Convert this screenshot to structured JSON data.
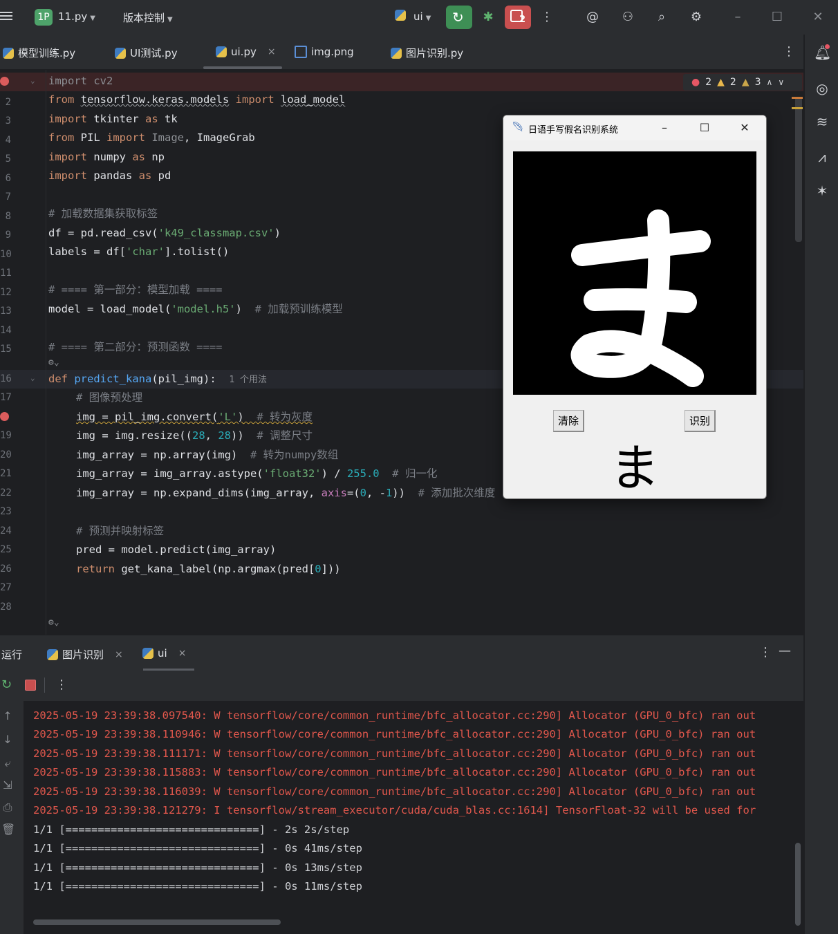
{
  "titlebar": {
    "project_badge": "1P",
    "project_name": "11.py",
    "vcs_label": "版本控制",
    "run_config": "ui",
    "badge_count": "2"
  },
  "tabs": [
    {
      "label": "模型训练.py",
      "icon": "python-file-icon"
    },
    {
      "label": "UI测试.py",
      "icon": "python-file-icon"
    },
    {
      "label": "ui.py",
      "icon": "python-file-icon",
      "active": true,
      "close": "×"
    },
    {
      "label": "img.png",
      "icon": "image-file-icon"
    },
    {
      "label": "图片识别.py",
      "icon": "python-file-icon"
    }
  ],
  "inspections": {
    "errors": "2",
    "warnings": "2",
    "weak_warnings": "3"
  },
  "line_numbers": [
    "1",
    "2",
    "3",
    "4",
    "5",
    "6",
    "7",
    "8",
    "9",
    "10",
    "11",
    "12",
    "13",
    "14",
    "15",
    "16",
    "17",
    "18",
    "19",
    "20",
    "21",
    "22",
    "23",
    "24",
    "25",
    "26",
    "27",
    "28"
  ],
  "code": {
    "l1": [
      "import",
      " cv2"
    ],
    "l2": [
      "from",
      "tensorflow.keras.models",
      "import",
      "load_model"
    ],
    "l3": [
      "import",
      " tkinter ",
      "as",
      " tk"
    ],
    "l4": [
      "from",
      " PIL ",
      "import",
      " Image",
      ", ImageGrab"
    ],
    "l5": [
      "import",
      " numpy ",
      "as",
      " np"
    ],
    "l6": [
      "import",
      " pandas ",
      "as",
      " pd"
    ],
    "l8": "# 加载数据集获取标签",
    "l9": [
      "df = pd.read_csv(",
      "'k49_classmap.csv'",
      ")"
    ],
    "l10": [
      "labels = df[",
      "'char'",
      "].tolist()"
    ],
    "l12": "# ==== 第一部分：模型加载 ====",
    "l13": [
      "model = load_model(",
      "'model.h5'",
      ")  ",
      "# 加载预训练模型"
    ],
    "l15": "# ==== 第二部分：预测函数 ====",
    "l16": [
      "def",
      "predict_kana",
      "(pil_img):",
      "1 个用法"
    ],
    "l17": "# 图像预处理",
    "l18": [
      "img = pil_img.convert(",
      "'L'",
      ")  ",
      "# 转为灰度"
    ],
    "l19": [
      "img = img.resize((",
      "28",
      ", ",
      "28",
      "))  ",
      "# 调整尺寸"
    ],
    "l20": [
      "img_array = np.array(img)  ",
      "# 转为numpy数组"
    ],
    "l21": [
      "img_array = img_array.astype(",
      "'float32'",
      ") / ",
      "255.0",
      "  ",
      "# 归一化"
    ],
    "l22": [
      "img_array = np.expand_dims(img_array, ",
      "axis",
      "=(",
      "0",
      ", -",
      "1",
      "))  ",
      "# 添加批次维度"
    ],
    "l24": "# 预测并映射标签",
    "l25": "pred = model.predict(img_array)",
    "l26": [
      "return",
      " get_kana_label(np.argmax(pred[",
      "0",
      "]))"
    ]
  },
  "tk_window": {
    "title": "日语手写假名识别系统",
    "clear_button": "清除",
    "recognize_button": "识别",
    "result": "ま",
    "drawn_char": "ま"
  },
  "run_panel": {
    "label": "运行",
    "tabs": [
      {
        "label": "图片识别",
        "close": "×"
      },
      {
        "label": "ui",
        "close": "×"
      }
    ]
  },
  "console": [
    {
      "text": "2025-05-19 23:39:38.097540: W tensorflow/core/common_runtime/bfc_allocator.cc:290] Allocator (GPU_0_bfc) ran out",
      "kind": "err"
    },
    {
      "text": "2025-05-19 23:39:38.110946: W tensorflow/core/common_runtime/bfc_allocator.cc:290] Allocator (GPU_0_bfc) ran out",
      "kind": "err"
    },
    {
      "text": "2025-05-19 23:39:38.111171: W tensorflow/core/common_runtime/bfc_allocator.cc:290] Allocator (GPU_0_bfc) ran out",
      "kind": "err"
    },
    {
      "text": "2025-05-19 23:39:38.115883: W tensorflow/core/common_runtime/bfc_allocator.cc:290] Allocator (GPU_0_bfc) ran out",
      "kind": "err"
    },
    {
      "text": "2025-05-19 23:39:38.116039: W tensorflow/core/common_runtime/bfc_allocator.cc:290] Allocator (GPU_0_bfc) ran out",
      "kind": "err"
    },
    {
      "text": "2025-05-19 23:39:38.121279: I tensorflow/stream_executor/cuda/cuda_blas.cc:1614] TensorFloat-32 will be used for",
      "kind": "err"
    },
    {
      "text": "1/1 [==============================] - 2s 2s/step",
      "kind": "out"
    },
    {
      "text": "1/1 [==============================] - 0s 41ms/step",
      "kind": "out"
    },
    {
      "text": "1/1 [==============================] - 0s 13ms/step",
      "kind": "out"
    },
    {
      "text": "1/1 [==============================] - 0s 11ms/step",
      "kind": "out"
    }
  ],
  "colors": {
    "background": "#1e1f22",
    "panel": "#2b2d30",
    "keyword": "#cf8e6d",
    "function": "#56a8f5",
    "string": "#6aab73",
    "number": "#2aacb8",
    "comment": "#7a7e85",
    "console_error": "#e1574c",
    "run_green": "#3e8f55",
    "stop_red": "#c94f4f"
  }
}
